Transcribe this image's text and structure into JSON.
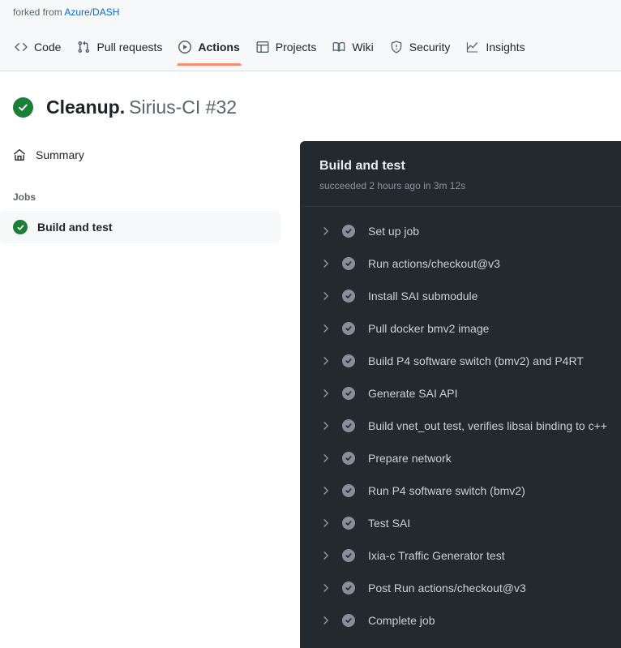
{
  "repo": {
    "forked_from_prefix": "forked from",
    "forked_from_repo": "Azure/DASH"
  },
  "nav": {
    "tabs": [
      {
        "label": "Code",
        "icon": "code-icon",
        "active": false
      },
      {
        "label": "Pull requests",
        "icon": "git-pull-request-icon",
        "active": false
      },
      {
        "label": "Actions",
        "icon": "play-circle-icon",
        "active": true
      },
      {
        "label": "Projects",
        "icon": "table-icon",
        "active": false
      },
      {
        "label": "Wiki",
        "icon": "book-icon",
        "active": false
      },
      {
        "label": "Security",
        "icon": "shield-icon",
        "active": false
      },
      {
        "label": "Insights",
        "icon": "graph-icon",
        "active": false
      }
    ],
    "active_underline_color": "#fd8c73"
  },
  "run": {
    "status_icon": "check-circle-icon",
    "status_color": "#1a7f37",
    "title": "Cleanup.",
    "subtitle": "Sirius-CI #32"
  },
  "sidebar": {
    "summary": {
      "label": "Summary",
      "icon": "home-icon"
    },
    "jobs_heading": "Jobs",
    "jobs": [
      {
        "label": "Build and test",
        "status_icon": "check-circle-icon",
        "selected": true
      }
    ]
  },
  "log_panel": {
    "job_title": "Build and test",
    "job_status": "succeeded 2 hours ago in 3m 12s",
    "background": "#24292f",
    "steps": [
      {
        "label": "Set up job",
        "status": "success"
      },
      {
        "label": "Run actions/checkout@v3",
        "status": "success"
      },
      {
        "label": "Install SAI submodule",
        "status": "success"
      },
      {
        "label": "Pull docker bmv2 image",
        "status": "success"
      },
      {
        "label": "Build P4 software switch (bmv2) and P4RT",
        "status": "success"
      },
      {
        "label": "Generate SAI API",
        "status": "success"
      },
      {
        "label": "Build vnet_out test, verifies libsai binding to c++",
        "status": "success"
      },
      {
        "label": "Prepare network",
        "status": "success"
      },
      {
        "label": "Run P4 software switch (bmv2)",
        "status": "success"
      },
      {
        "label": "Test SAI",
        "status": "success"
      },
      {
        "label": "Ixia-c Traffic Generator test",
        "status": "success"
      },
      {
        "label": "Post Run actions/checkout@v3",
        "status": "success"
      },
      {
        "label": "Complete job",
        "status": "success"
      }
    ]
  }
}
